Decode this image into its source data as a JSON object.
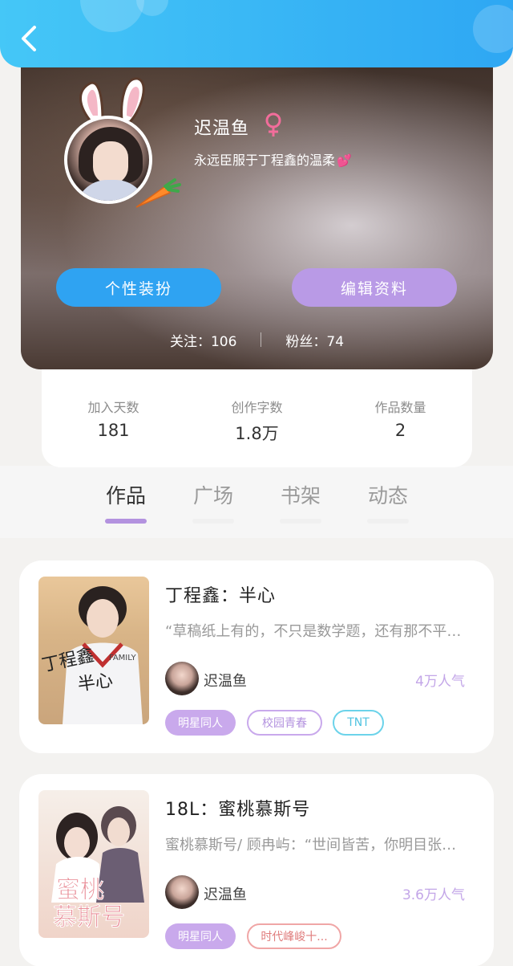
{
  "header": {
    "back_icon": "chevron-left-icon"
  },
  "profile": {
    "username": "迟温鱼",
    "gender_icon": "female-icon",
    "bio": "永远臣服于丁程鑫的温柔",
    "bio_emoji": "💕",
    "style_button": "个性装扮",
    "edit_button": "编辑资料",
    "following": "关注：106",
    "followers": "粉丝：74"
  },
  "stats": [
    {
      "label": "加入天数",
      "value": "181"
    },
    {
      "label": "创作字数",
      "value": "1.8万"
    },
    {
      "label": "作品数量",
      "value": "2"
    }
  ],
  "tabs": [
    {
      "label": "作品",
      "active": true
    },
    {
      "label": "广场",
      "active": false
    },
    {
      "label": "书架",
      "active": false
    },
    {
      "label": "动态",
      "active": false
    }
  ],
  "works": [
    {
      "title": "丁程鑫：半心",
      "desc": "“草稿纸上有的，不只是数学题，还有那不平…",
      "author": "迟温鱼",
      "popularity": "4万人气",
      "tags": [
        "明星同人",
        "校园青春",
        "TNT"
      ]
    },
    {
      "title": "18L：蜜桃慕斯号",
      "desc": "蜜桃慕斯号/ 顾冉屿：“世间皆苦，你明目张…",
      "author": "迟温鱼",
      "popularity": "3.6万人气",
      "tags": [
        "明星同人",
        "时代峰峻十..."
      ]
    }
  ],
  "colors": {
    "header": "#2ea7f3",
    "style_button": "#2fa3f2",
    "edit_button": "#b99ae6",
    "accent_purple": "#b392df",
    "popularity": "#c3a6e8"
  }
}
